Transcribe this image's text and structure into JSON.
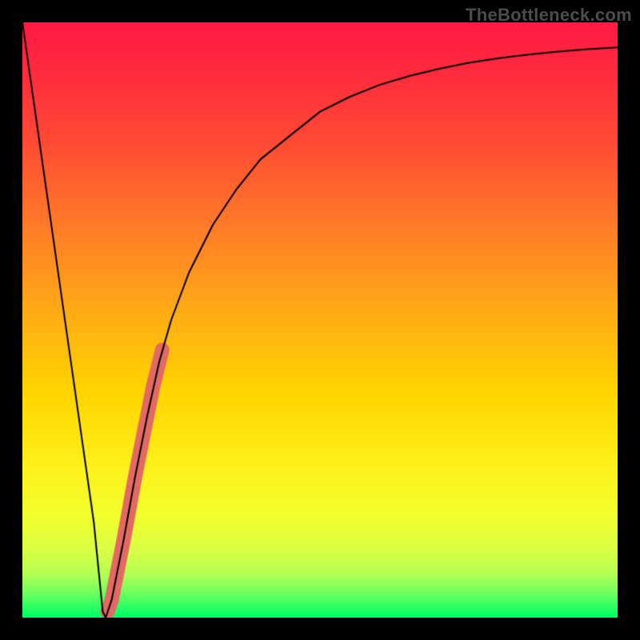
{
  "watermark": "TheBottleneck.com",
  "chart_data": {
    "type": "line",
    "title": "",
    "xlabel": "",
    "ylabel": "",
    "xlim": [
      0,
      100
    ],
    "ylim": [
      0,
      100
    ],
    "grid": false,
    "axes_visible": false,
    "background_gradient": {
      "top_color": "#ff1a44",
      "mid_color": "#ffd400",
      "bottom_color": "#00ff66"
    },
    "series": [
      {
        "name": "black-curve",
        "color": "#000000",
        "width": 2,
        "x": [
          0,
          2,
          4,
          6,
          8,
          10,
          12,
          13,
          13.5,
          14,
          15,
          17,
          19,
          21,
          23,
          25,
          28,
          32,
          36,
          40,
          45,
          50,
          55,
          60,
          65,
          70,
          75,
          80,
          85,
          90,
          95,
          100
        ],
        "values": [
          100,
          86,
          72,
          58,
          44,
          30,
          16,
          6,
          1,
          0,
          3,
          13,
          24,
          34,
          43,
          50,
          58,
          66,
          72,
          77,
          81,
          85,
          87.5,
          89.5,
          91,
          92.2,
          93.2,
          94,
          94.6,
          95.1,
          95.5,
          95.8
        ]
      },
      {
        "name": "highlight-band",
        "color": "#e26a62",
        "width": 18,
        "x": [
          14.3,
          15,
          16,
          17,
          18,
          19,
          20,
          21,
          22,
          23,
          23.5
        ],
        "values": [
          1.0,
          3,
          8,
          13,
          18.5,
          24,
          29,
          34,
          39,
          43,
          45
        ]
      }
    ]
  }
}
